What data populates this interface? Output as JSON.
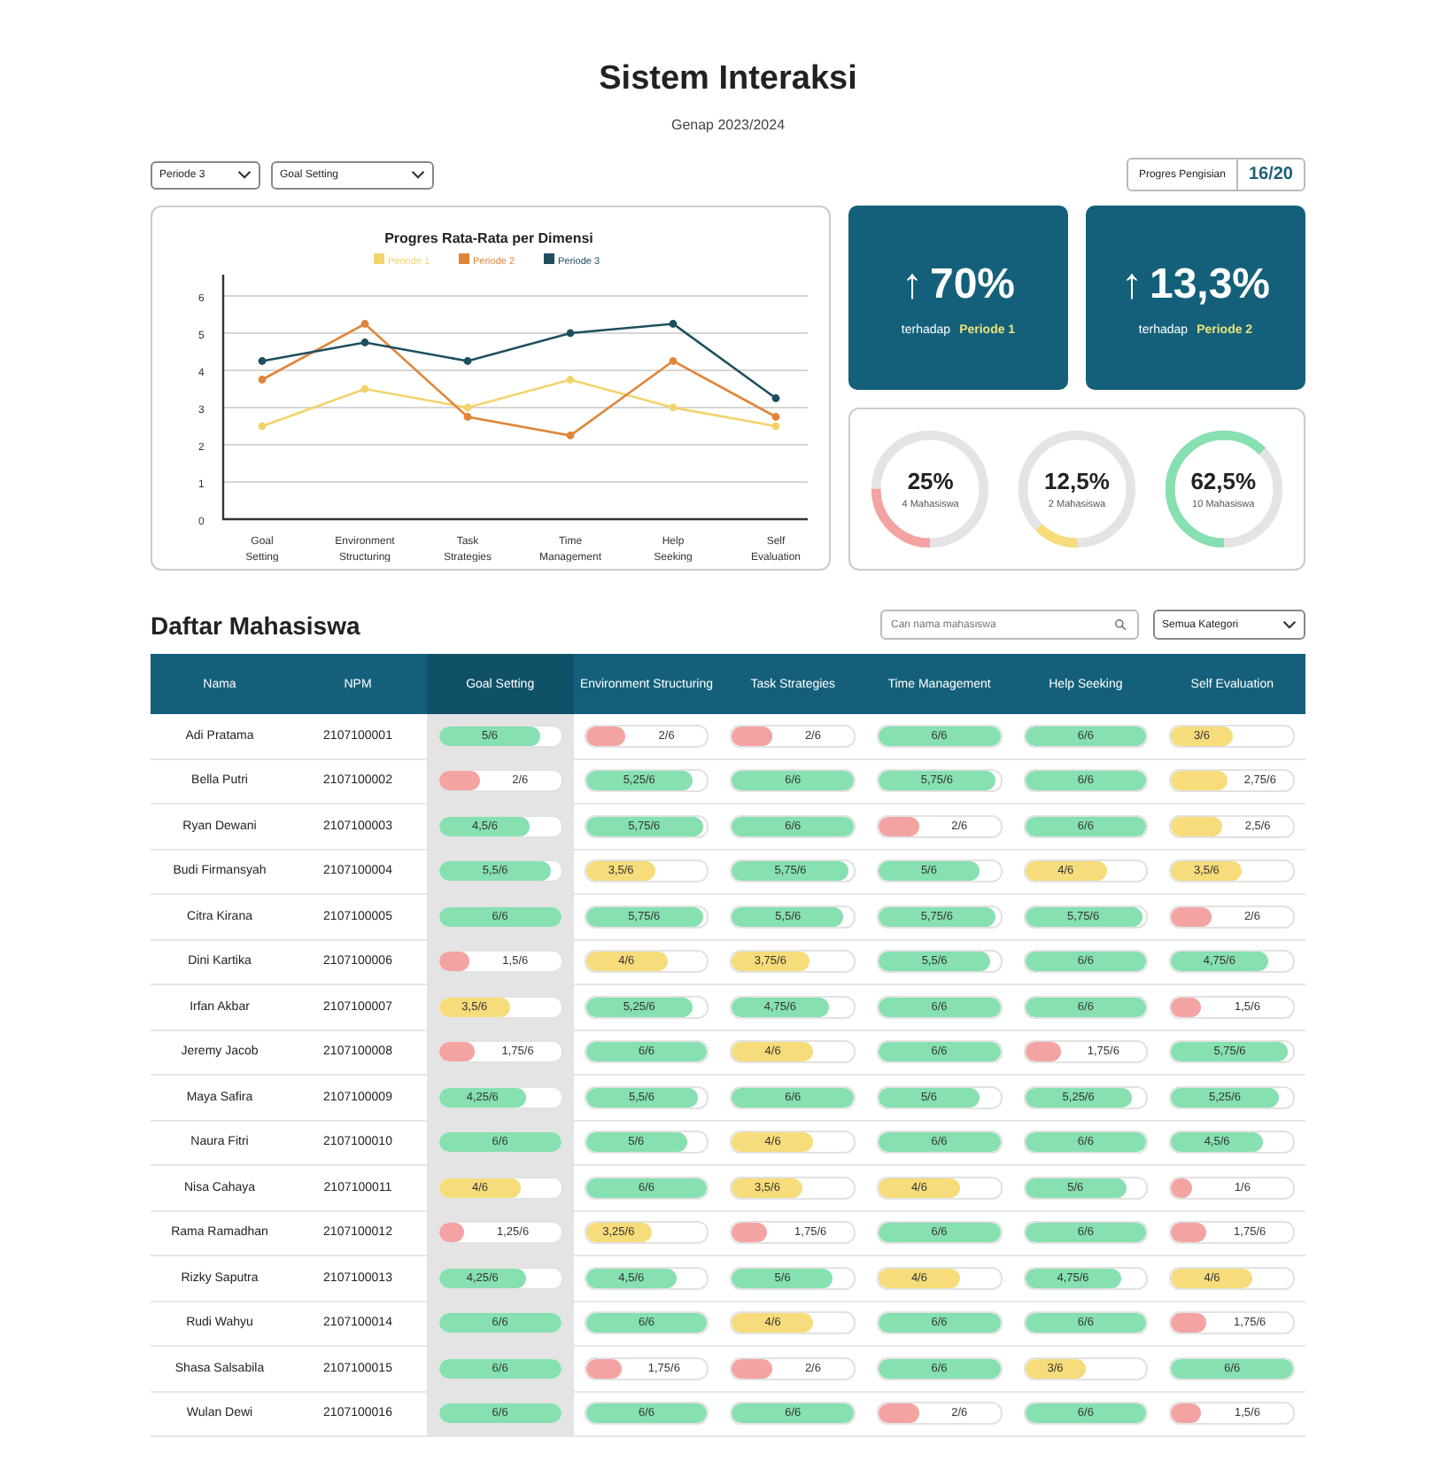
{
  "header": {
    "title": "Sistem Interaksi",
    "subtitle": "Genap 2023/2024"
  },
  "filters": [
    {
      "value": "Periode 3"
    },
    {
      "value": "Goal Setting"
    }
  ],
  "progress": {
    "label": "Progres Pengisian",
    "value": "16/20"
  },
  "chart": {
    "chart_data": {
      "type": "line",
      "title": "Progres Rata-Rata per Dimensi",
      "categories": [
        "Goal Setting",
        "Environment Structuring",
        "Task Strategies",
        "Time Management",
        "Help Seeking",
        "Self Evaluation"
      ],
      "ylim": [
        0,
        6
      ],
      "yticks": [
        0,
        1,
        2,
        3,
        4,
        5,
        6
      ],
      "grid": true,
      "legend": true,
      "series": [
        {
          "name": "Periode 1",
          "color": "#f2d36b",
          "marker": "circle",
          "values": [
            2.5,
            3.5,
            3,
            3.75,
            3,
            2.5
          ]
        },
        {
          "name": "Periode 2",
          "color": "#e0863a",
          "marker": "circle",
          "values": [
            3.75,
            5.25,
            2.75,
            2.25,
            4.25,
            2.75
          ]
        },
        {
          "name": "Periode 3",
          "color": "#1d4f5e",
          "marker": "circle",
          "values": [
            4.25,
            4.75,
            4.25,
            5,
            5.25,
            3.25
          ]
        }
      ]
    }
  },
  "stat_cards": [
    {
      "arrow": "↑",
      "value": "70%",
      "caption": "terhadap",
      "reference": "Periode 1"
    },
    {
      "arrow": "↑",
      "value": "13,3%",
      "caption": "terhadap",
      "reference": "Periode 2"
    }
  ],
  "donuts": [
    {
      "value": "25%",
      "caption": "4 Mahasiswa",
      "level": 0.25,
      "color": "#f4a3a3"
    },
    {
      "value": "12,5%",
      "caption": "2 Mahasiswa",
      "level": 0.125,
      "color": "#f6dc7a"
    },
    {
      "value": "62,5%",
      "caption": "10 Mahasiswa",
      "level": 0.625,
      "color": "#86e0b0"
    }
  ],
  "list": {
    "title": "Daftar Mahasiswa",
    "search": {
      "placeholder": "Cari nama mahasiswa"
    },
    "category": "Semua Kategori"
  },
  "table": {
    "columns": [
      {
        "label": "Nama",
        "highlighted": false
      },
      {
        "label": "NPM",
        "highlighted": false
      },
      {
        "label": "Goal Setting",
        "highlighted": true
      },
      {
        "label": "Environment Structuring",
        "highlighted": false
      },
      {
        "label": "Task Strategies",
        "highlighted": false
      },
      {
        "label": "Time Management",
        "highlighted": false
      },
      {
        "label": "Help Seeking",
        "highlighted": false
      },
      {
        "label": "Self Evaluation",
        "highlighted": false
      }
    ],
    "rows": [
      {
        "name": "Adi Pratama",
        "npm": "2107100001",
        "scores": [
          {
            "text": "5/6",
            "level": 0.83
          },
          {
            "text": "2/6",
            "level": 0.33
          },
          {
            "text": "2/6",
            "level": 0.33
          },
          {
            "text": "6/6",
            "level": 1
          },
          {
            "text": "6/6",
            "level": 1
          },
          {
            "text": "3/6",
            "level": 0.5
          }
        ]
      },
      {
        "name": "Bella Putri",
        "npm": "2107100002",
        "scores": [
          {
            "text": "2/6",
            "level": 0.33
          },
          {
            "text": "5,25/6",
            "level": 0.88
          },
          {
            "text": "6/6",
            "level": 1
          },
          {
            "text": "5,75/6",
            "level": 0.96
          },
          {
            "text": "6/6",
            "level": 1
          },
          {
            "text": "2,75/6",
            "level": 0.46
          }
        ]
      },
      {
        "name": "Ryan Dewani",
        "npm": "2107100003",
        "scores": [
          {
            "text": "4,5/6",
            "level": 0.75
          },
          {
            "text": "5,75/6",
            "level": 0.96
          },
          {
            "text": "6/6",
            "level": 1
          },
          {
            "text": "2/6",
            "level": 0.33
          },
          {
            "text": "6/6",
            "level": 1
          },
          {
            "text": "2,5/6",
            "level": 0.42
          }
        ]
      },
      {
        "name": "Budi Firmansyah",
        "npm": "2107100004",
        "scores": [
          {
            "text": "5,5/6",
            "level": 0.92
          },
          {
            "text": "3,5/6",
            "level": 0.58
          },
          {
            "text": "5,75/6",
            "level": 0.96
          },
          {
            "text": "5/6",
            "level": 0.83
          },
          {
            "text": "4/6",
            "level": 0.67
          },
          {
            "text": "3,5/6",
            "level": 0.58
          }
        ]
      },
      {
        "name": "Citra Kirana",
        "npm": "2107100005",
        "scores": [
          {
            "text": "6/6",
            "level": 1
          },
          {
            "text": "5,75/6",
            "level": 0.96
          },
          {
            "text": "5,5/6",
            "level": 0.92
          },
          {
            "text": "5,75/6",
            "level": 0.96
          },
          {
            "text": "5,75/6",
            "level": 0.96
          },
          {
            "text": "2/6",
            "level": 0.33
          }
        ]
      },
      {
        "name": "Dini Kartika",
        "npm": "2107100006",
        "scores": [
          {
            "text": "1,5/6",
            "level": 0.25
          },
          {
            "text": "4/6",
            "level": 0.67
          },
          {
            "text": "3,75/6",
            "level": 0.63
          },
          {
            "text": "5,5/6",
            "level": 0.92
          },
          {
            "text": "6/6",
            "level": 1
          },
          {
            "text": "4,75/6",
            "level": 0.79
          }
        ]
      },
      {
        "name": "Irfan Akbar",
        "npm": "2107100007",
        "scores": [
          {
            "text": "3,5/6",
            "level": 0.58
          },
          {
            "text": "5,25/6",
            "level": 0.88
          },
          {
            "text": "4,75/6",
            "level": 0.79
          },
          {
            "text": "6/6",
            "level": 1
          },
          {
            "text": "6/6",
            "level": 1
          },
          {
            "text": "1,5/6",
            "level": 0.25
          }
        ]
      },
      {
        "name": "Jeremy Jacob",
        "npm": "2107100008",
        "scores": [
          {
            "text": "1,75/6",
            "level": 0.29
          },
          {
            "text": "6/6",
            "level": 1
          },
          {
            "text": "4/6",
            "level": 0.67
          },
          {
            "text": "6/6",
            "level": 1
          },
          {
            "text": "1,75/6",
            "level": 0.29
          },
          {
            "text": "5,75/6",
            "level": 0.96
          }
        ]
      },
      {
        "name": "Maya Safira",
        "npm": "2107100009",
        "scores": [
          {
            "text": "4,25/6",
            "level": 0.71
          },
          {
            "text": "5,5/6",
            "level": 0.92
          },
          {
            "text": "6/6",
            "level": 1
          },
          {
            "text": "5/6",
            "level": 0.83
          },
          {
            "text": "5,25/6",
            "level": 0.88
          },
          {
            "text": "5,25/6",
            "level": 0.88
          }
        ]
      },
      {
        "name": "Naura Fitri",
        "npm": "2107100010",
        "scores": [
          {
            "text": "6/6",
            "level": 1
          },
          {
            "text": "5/6",
            "level": 0.83
          },
          {
            "text": "4/6",
            "level": 0.67
          },
          {
            "text": "6/6",
            "level": 1
          },
          {
            "text": "6/6",
            "level": 1
          },
          {
            "text": "4,5/6",
            "level": 0.75
          }
        ]
      },
      {
        "name": "Nisa Cahaya",
        "npm": "2107100011",
        "scores": [
          {
            "text": "4/6",
            "level": 0.67
          },
          {
            "text": "6/6",
            "level": 1
          },
          {
            "text": "3,5/6",
            "level": 0.58
          },
          {
            "text": "4/6",
            "level": 0.67
          },
          {
            "text": "5/6",
            "level": 0.83
          },
          {
            "text": "1/6",
            "level": 0.17
          }
        ]
      },
      {
        "name": "Rama Ramadhan",
        "npm": "2107100012",
        "scores": [
          {
            "text": "1,25/6",
            "level": 0.21
          },
          {
            "text": "3,25/6",
            "level": 0.54
          },
          {
            "text": "1,75/6",
            "level": 0.29
          },
          {
            "text": "6/6",
            "level": 1
          },
          {
            "text": "6/6",
            "level": 1
          },
          {
            "text": "1,75/6",
            "level": 0.29
          }
        ]
      },
      {
        "name": "Rizky Saputra",
        "npm": "2107100013",
        "scores": [
          {
            "text": "4,25/6",
            "level": 0.71
          },
          {
            "text": "4,5/6",
            "level": 0.75
          },
          {
            "text": "5/6",
            "level": 0.83
          },
          {
            "text": "4/6",
            "level": 0.67
          },
          {
            "text": "4,75/6",
            "level": 0.79
          },
          {
            "text": "4/6",
            "level": 0.67
          }
        ]
      },
      {
        "name": "Rudi Wahyu",
        "npm": "2107100014",
        "scores": [
          {
            "text": "6/6",
            "level": 1
          },
          {
            "text": "6/6",
            "level": 1
          },
          {
            "text": "4/6",
            "level": 0.67
          },
          {
            "text": "6/6",
            "level": 1
          },
          {
            "text": "6/6",
            "level": 1
          },
          {
            "text": "1,75/6",
            "level": 0.29
          }
        ]
      },
      {
        "name": "Shasa Salsabila",
        "npm": "2107100015",
        "scores": [
          {
            "text": "6/6",
            "level": 1
          },
          {
            "text": "1,75/6",
            "level": 0.29
          },
          {
            "text": "2/6",
            "level": 0.33
          },
          {
            "text": "6/6",
            "level": 1
          },
          {
            "text": "3/6",
            "level": 0.5
          },
          {
            "text": "6/6",
            "level": 1
          }
        ]
      },
      {
        "name": "Wulan Dewi",
        "npm": "2107100016",
        "scores": [
          {
            "text": "6/6",
            "level": 1
          },
          {
            "text": "6/6",
            "level": 1
          },
          {
            "text": "6/6",
            "level": 1
          },
          {
            "text": "2/6",
            "level": 0.33
          },
          {
            "text": "6/6",
            "level": 1
          },
          {
            "text": "1,5/6",
            "level": 0.25
          }
        ]
      }
    ]
  }
}
